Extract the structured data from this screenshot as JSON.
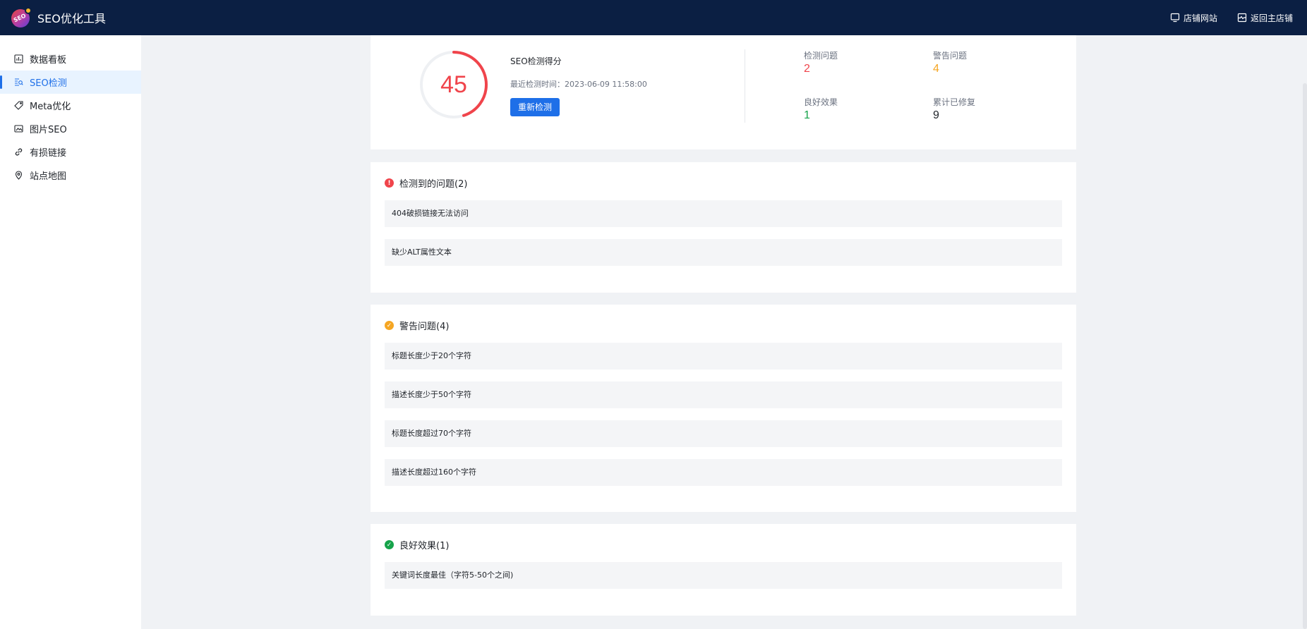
{
  "app": {
    "title": "SEO优化工具",
    "logo_text": "SEO",
    "actions": [
      {
        "label": "店铺网站",
        "icon": "monitor-icon"
      },
      {
        "label": "返回主店铺",
        "icon": "store-icon"
      }
    ]
  },
  "sidebar": {
    "items": [
      {
        "label": "数据看板",
        "icon": "dashboard-icon",
        "active": false
      },
      {
        "label": "SEO检测",
        "icon": "scan-icon",
        "active": true
      },
      {
        "label": "Meta优化",
        "icon": "tag-icon",
        "active": false
      },
      {
        "label": "图片SEO",
        "icon": "image-icon",
        "active": false
      },
      {
        "label": "有损链接",
        "icon": "link-icon",
        "active": false
      },
      {
        "label": "站点地图",
        "icon": "location-icon",
        "active": false
      }
    ]
  },
  "score": {
    "value": "45",
    "progress": 0.45,
    "title": "SEO检测得分",
    "last_check": "最近检测时间：2023-06-09 11:58:00",
    "recheck_label": "重新检测"
  },
  "stats": [
    {
      "label": "检测问题",
      "value": "2",
      "color": "#f0444b"
    },
    {
      "label": "警告问题",
      "value": "4",
      "color": "#f5a623"
    },
    {
      "label": "良好效果",
      "value": "1",
      "color": "#16a34a"
    },
    {
      "label": "累计已修复",
      "value": "9",
      "color": "#1f2329"
    }
  ],
  "sections": {
    "issues": {
      "title": "检测到的问题(2)",
      "color": "#f0444b",
      "items": [
        "404破损链接无法访问",
        "缺少ALT属性文本"
      ]
    },
    "warnings": {
      "title": "警告问题(4)",
      "color": "#f5a623",
      "items": [
        "标题长度少于20个字符",
        "描述长度少于50个字符",
        "标题长度超过70个字符",
        "描述长度超过160个字符"
      ]
    },
    "good": {
      "title": "良好效果(1)",
      "color": "#16a34a",
      "items": [
        "关键词长度最佳（字符5-50个之间)"
      ]
    }
  },
  "colors": {
    "accent": "#1e6fe8",
    "topbar": "#0b1f43",
    "score_ring": "#f0444b"
  }
}
